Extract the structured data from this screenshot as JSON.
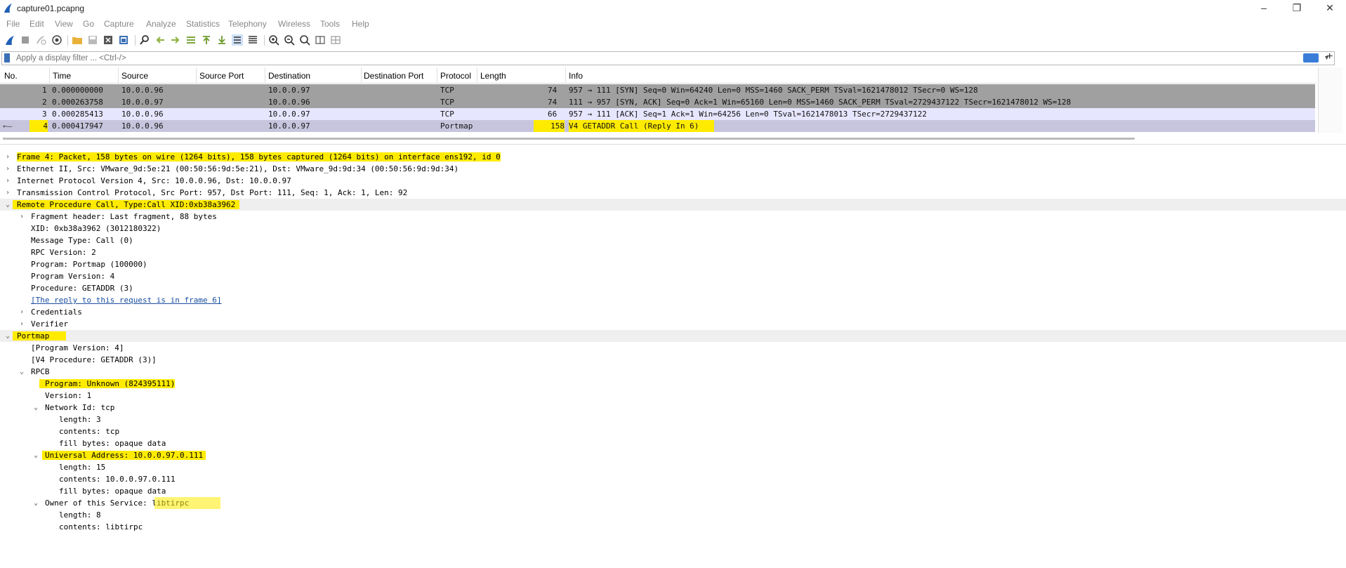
{
  "window": {
    "title": "capture01.pcapng"
  },
  "menu": [
    "File",
    "Edit",
    "View",
    "Go",
    "Capture",
    "Analyze",
    "Statistics",
    "Telephony",
    "Wireless",
    "Tools",
    "Help"
  ],
  "filter": {
    "placeholder": "Apply a display filter ... <Ctrl-/>"
  },
  "columns": [
    "No.",
    "Time",
    "Source",
    "Source Port",
    "Destination",
    "Destination Port",
    "Protocol",
    "Length",
    "Info"
  ],
  "packets": [
    {
      "no": "1",
      "time": "0.000000000",
      "source": "10.0.0.96",
      "destination": "10.0.0.97",
      "protocol": "TCP",
      "length": "74",
      "info": "957 → 111 [SYN] Seq=0 Win=64240 Len=0 MSS=1460 SACK_PERM TSval=1621478012 TSecr=0 WS=128"
    },
    {
      "no": "2",
      "time": "0.000263758",
      "source": "10.0.0.97",
      "destination": "10.0.0.96",
      "protocol": "TCP",
      "length": "74",
      "info": "111 → 957 [SYN, ACK] Seq=0 Ack=1 Win=65160 Len=0 MSS=1460 SACK_PERM TSval=2729437122 TSecr=1621478012 WS=128"
    },
    {
      "no": "3",
      "time": "0.000285413",
      "source": "10.0.0.96",
      "destination": "10.0.0.97",
      "protocol": "TCP",
      "length": "66",
      "info": "957 → 111 [ACK] Seq=1 Ack=1 Win=64256 Len=0 TSval=1621478013 TSecr=2729437122"
    },
    {
      "no": "4",
      "time": "0.000417947",
      "source": "10.0.0.96",
      "destination": "10.0.0.97",
      "protocol": "Portmap",
      "length": "158",
      "info": "V4 GETADDR Call (Reply In 6)"
    }
  ],
  "details": [
    {
      "text": "Frame 4: Packet, 158 bytes on wire (1264 bits), 158 bytes captured (1264 bits) on interface ens192, id 0"
    },
    {
      "text": "Ethernet II, Src: VMware_9d:5e:21 (00:50:56:9d:5e:21), Dst: VMware_9d:9d:34 (00:50:56:9d:9d:34)"
    },
    {
      "text": "Internet Protocol Version 4, Src: 10.0.0.96, Dst: 10.0.0.97"
    },
    {
      "text": "Transmission Control Protocol, Src Port: 957, Dst Port: 111, Seq: 1, Ack: 1, Len: 92"
    },
    {
      "text": "Remote Procedure Call, Type:Call XID:0xb38a3962"
    },
    {
      "text": "Fragment header: Last fragment, 88 bytes"
    },
    {
      "text": "XID: 0xb38a3962 (3012180322)"
    },
    {
      "text": "Message Type: Call (0)"
    },
    {
      "text": "RPC Version: 2"
    },
    {
      "text": "Program: Portmap (100000)"
    },
    {
      "text": "Program Version: 4"
    },
    {
      "text": "Procedure: GETADDR (3)"
    },
    {
      "text": "[The reply to this request is in frame 6]"
    },
    {
      "text": "Credentials"
    },
    {
      "text": "Verifier"
    },
    {
      "text": "Portmap"
    },
    {
      "text": "[Program Version: 4]"
    },
    {
      "text": "[V4 Procedure: GETADDR (3)]"
    },
    {
      "text": "RPCB"
    },
    {
      "text": "Program: Unknown (824395111)"
    },
    {
      "text": "Version: 1"
    },
    {
      "text": "Network Id: tcp"
    },
    {
      "text": "length: 3"
    },
    {
      "text": "contents: tcp"
    },
    {
      "text": "fill bytes: opaque data"
    },
    {
      "text": "Universal Address: 10.0.0.97.0.111"
    },
    {
      "text": "length: 15"
    },
    {
      "text": "contents: 10.0.0.97.0.111"
    },
    {
      "text": "fill bytes: opaque data"
    },
    {
      "text": "Owner of this Service: libtirpc"
    },
    {
      "text": "length: 8"
    },
    {
      "text": "contents: libtirpc"
    }
  ],
  "colors": {
    "highlight": "#ffeb00",
    "row_grey": "#a0a0a0",
    "row_light": "#e7e6ff",
    "row_selected": "#c6c5dd",
    "link": "#1a4fa0"
  }
}
